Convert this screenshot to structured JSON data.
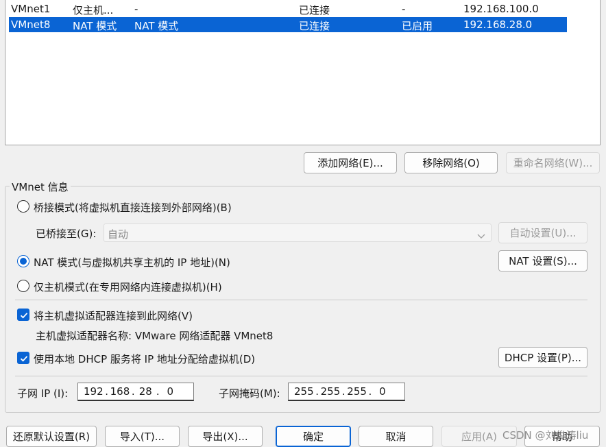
{
  "networks": [
    {
      "name": "VMnet1",
      "type": "仅主机...",
      "external": "-",
      "status": "已连接",
      "dhcp": "-",
      "subnet": "192.168.100.0",
      "selected": false
    },
    {
      "name": "VMnet8",
      "type": "NAT 模式",
      "external": "NAT 模式",
      "status": "已连接",
      "dhcp": "已启用",
      "subnet": "192.168.28.0",
      "selected": true
    }
  ],
  "net_buttons": {
    "add": "添加网络(E)...",
    "remove": "移除网络(O)",
    "rename": "重命名网络(W)..."
  },
  "vmnet_info": {
    "title": "VMnet 信息",
    "bridged_label": "桥接模式(将虚拟机直接连接到外部网络)(B)",
    "bridged_to_label": "已桥接至(G):",
    "bridged_to_value": "自动",
    "auto_settings": "自动设置(U)...",
    "nat_label": "NAT 模式(与虚拟机共享主机的 IP 地址)(N)",
    "nat_settings": "NAT 设置(S)...",
    "hostonly_label": "仅主机模式(在专用网络内连接虚拟机)(H)",
    "selected_mode": "nat",
    "connect_adapter_label": "将主机虚拟适配器连接到此网络(V)",
    "connect_adapter_checked": true,
    "adapter_name_label": "主机虚拟适配器名称: VMware 网络适配器 VMnet8",
    "dhcp_label": "使用本地 DHCP 服务将 IP 地址分配给虚拟机(D)",
    "dhcp_checked": true,
    "dhcp_settings": "DHCP 设置(P)...",
    "subnet_ip_label": "子网 IP (I):",
    "subnet_ip": [
      "192",
      "168",
      "28",
      "0"
    ],
    "subnet_mask_label": "子网掩码(M):",
    "subnet_mask": [
      "255",
      "255",
      "255",
      "0"
    ]
  },
  "footer": {
    "restore": "还原默认设置(R)",
    "import": "导入(T)...",
    "export": "导出(X)...",
    "ok": "确定",
    "cancel": "取消",
    "apply": "应用(A)",
    "help": "帮助"
  },
  "watermark": "CSDN @刘俊涛liu",
  "colors": {
    "accent": "#0a64d4",
    "selection": "#0a64d4"
  }
}
